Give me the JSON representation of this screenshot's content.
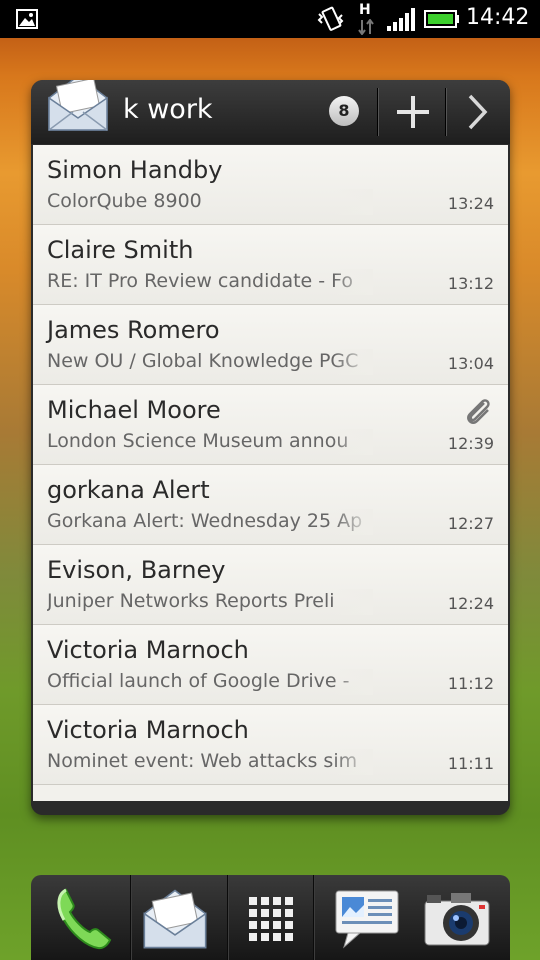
{
  "status_bar": {
    "time": "14:42",
    "network_label": "H",
    "icons": [
      "image-notification-icon",
      "vibrate-icon",
      "network-h-icon",
      "signal-icon",
      "battery-icon"
    ]
  },
  "widget": {
    "account": "k work",
    "unread_count": "8",
    "add_icon": "plus-icon",
    "next_icon": "chevron-right-icon",
    "messages": [
      {
        "sender": "Simon Handby",
        "subject": "ColorQube 8900",
        "time": "13:24",
        "attachment": false
      },
      {
        "sender": "Claire Smith",
        "subject": "RE: IT Pro Review candidate - Fo",
        "time": "13:12",
        "attachment": false
      },
      {
        "sender": "James Romero",
        "subject": "New OU / Global Knowledge PGC",
        "time": "13:04",
        "attachment": false
      },
      {
        "sender": "Michael Moore",
        "subject": "London Science Museum annou",
        "time": "12:39",
        "attachment": true
      },
      {
        "sender": "gorkana Alert",
        "subject": "Gorkana Alert: Wednesday 25 Ap",
        "time": "12:27",
        "attachment": false
      },
      {
        "sender": "Evison, Barney",
        "subject": "Juniper Networks Reports Preli",
        "time": "12:24",
        "attachment": false
      },
      {
        "sender": "Victoria Marnoch",
        "subject": "Official launch of Google Drive -",
        "time": "11:12",
        "attachment": false
      },
      {
        "sender": "Victoria Marnoch",
        "subject": "Nominet event: Web attacks sim",
        "time": "11:11",
        "attachment": false
      }
    ]
  },
  "dock": {
    "items": [
      "phone-icon",
      "mail-icon",
      "app-drawer-icon",
      "messages-icon",
      "camera-icon"
    ]
  },
  "colors": {
    "status_bar": "#000000",
    "widget_header": "#2b2b2b",
    "list_background": "#f2f1ec",
    "battery_green": "#3ccf2c"
  }
}
